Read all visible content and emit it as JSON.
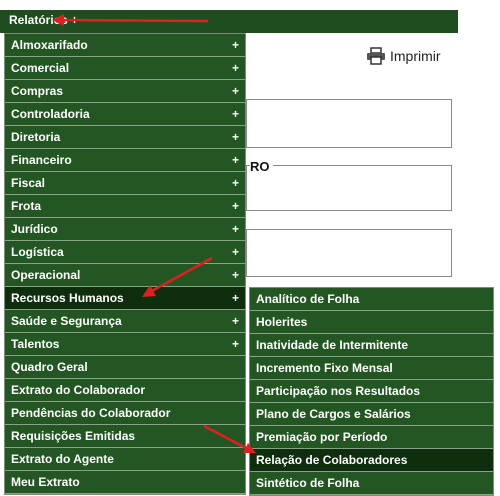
{
  "menubar": {
    "title": "Relatórios +"
  },
  "background": {
    "print_label": "Imprimir",
    "legend_fragment": "RO"
  },
  "menu": {
    "items": [
      {
        "label": "Almoxarifado",
        "plus": "+"
      },
      {
        "label": "Comercial",
        "plus": "+"
      },
      {
        "label": "Compras",
        "plus": "+"
      },
      {
        "label": "Controladoria",
        "plus": "+"
      },
      {
        "label": "Diretoria",
        "plus": "+"
      },
      {
        "label": "Financeiro",
        "plus": "+"
      },
      {
        "label": "Fiscal",
        "plus": "+"
      },
      {
        "label": "Frota",
        "plus": "+"
      },
      {
        "label": "Jurídico",
        "plus": "+"
      },
      {
        "label": "Logística",
        "plus": "+"
      },
      {
        "label": "Operacional",
        "plus": "+"
      },
      {
        "label": "Recursos Humanos",
        "plus": "+"
      },
      {
        "label": "Saúde e Segurança",
        "plus": "+"
      },
      {
        "label": "Talentos",
        "plus": "+"
      },
      {
        "label": "Quadro Geral",
        "plus": ""
      },
      {
        "label": "Extrato do Colaborador",
        "plus": ""
      },
      {
        "label": "Pendências do Colaborador",
        "plus": ""
      },
      {
        "label": "Requisições Emitidas",
        "plus": ""
      },
      {
        "label": "Extrato do Agente",
        "plus": ""
      },
      {
        "label": "Meu Extrato",
        "plus": ""
      }
    ]
  },
  "submenu": {
    "items": [
      {
        "label": "Analítico de Folha"
      },
      {
        "label": "Holerites"
      },
      {
        "label": "Inatividade de Intermitente"
      },
      {
        "label": "Incremento Fixo Mensal"
      },
      {
        "label": "Participação nos Resultados"
      },
      {
        "label": "Plano de Cargos e Salários"
      },
      {
        "label": "Premiação por Período"
      },
      {
        "label": "Relação de Colaboradores"
      },
      {
        "label": "Sintético de Folha"
      }
    ]
  },
  "colors": {
    "menu_bg": "#245624",
    "menu_active": "#0e2e0e",
    "annotation_arrow": "#e02020"
  }
}
